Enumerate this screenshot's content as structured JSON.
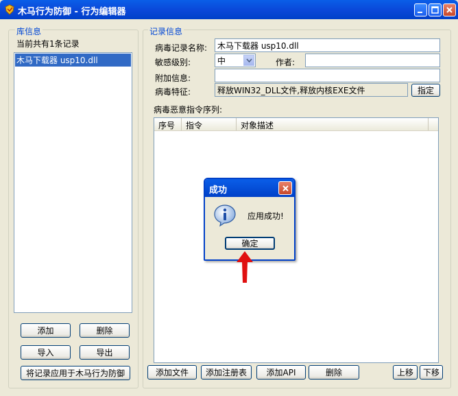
{
  "window": {
    "title": "木马行为防御 - 行为编辑器"
  },
  "library": {
    "group_title": "库信息",
    "count_text": "当前共有1条记录",
    "items": [
      "木马下载器 usp10.dll"
    ],
    "buttons": {
      "add": "添加",
      "delete": "删除",
      "import": "导入",
      "export": "导出",
      "apply": "将记录应用于木马行为防御"
    }
  },
  "record": {
    "group_title": "记录信息",
    "name_label": "病毒记录名称:",
    "name_value": "木马下载器 usp10.dll",
    "level_label": "敏感级别:",
    "level_value": "中",
    "author_label": "作者:",
    "author_value": "",
    "extra_label": "附加信息:",
    "extra_value": "",
    "feature_label": "病毒特征:",
    "feature_value": "释放WIN32_DLL文件,释放内核EXE文件",
    "specify_button": "指定",
    "sequence_label": "病毒恶意指令序列:",
    "columns": [
      "序号",
      "指令",
      "对象描述"
    ],
    "buttons": {
      "add_file": "添加文件",
      "add_registry": "添加注册表",
      "add_api": "添加API",
      "delete": "删除",
      "move_up": "上移",
      "move_down": "下移"
    }
  },
  "dialog": {
    "title": "成功",
    "message": "应用成功!",
    "ok_label": "确定"
  },
  "colors": {
    "titlebar": "#0a47d8",
    "group_title": "#0046d5",
    "selection": "#316ac5",
    "arrow": "#e01010"
  },
  "icons": {
    "app": "shield-icon",
    "dialog": "info-icon",
    "annotation": "red-arrow-icon"
  }
}
